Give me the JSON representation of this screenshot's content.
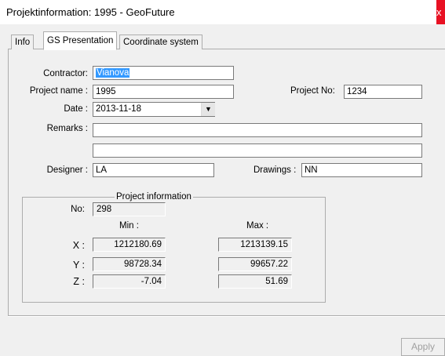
{
  "window": {
    "title": "Projektinformation: 1995 - GeoFuture",
    "close_icon": "close-icon",
    "close_glyph": "x"
  },
  "tabs": [
    {
      "label": "Info",
      "active": false
    },
    {
      "label": "GS Presentation",
      "active": true
    },
    {
      "label": "Coordinate system",
      "active": false
    }
  ],
  "form": {
    "contractor_label": "Contractor:",
    "contractor_value": "Vianova",
    "project_name_label": "Project name :",
    "project_name_value": "1995",
    "project_no_label": "Project No:",
    "project_no_value": "1234",
    "date_label": "Date :",
    "date_value": "2013-11-18",
    "date_dropdown_icon": "chevron-down-icon",
    "dropdown_glyph": "▼",
    "remarks_label": "Remarks :",
    "remarks_line1": "",
    "remarks_line2": "",
    "designer_label": "Designer :",
    "designer_value": "LA",
    "drawings_label": "Drawings :",
    "drawings_value": "NN"
  },
  "project_info": {
    "group_title": "Project information",
    "no_label": "No:",
    "no_value": "298",
    "min_header": "Min :",
    "max_header": "Max :",
    "rows": [
      {
        "label": "X :",
        "min": "1212180.69",
        "max": "1213139.15"
      },
      {
        "label": "Y :",
        "min": "98728.34",
        "max": "99657.22"
      },
      {
        "label": "Z :",
        "min": "-7.04",
        "max": "51.69"
      }
    ]
  },
  "buttons": {
    "apply_label": "Apply"
  },
  "colors": {
    "selection": "#3399ff",
    "close": "#e81123",
    "background": "#f0f0f0"
  }
}
